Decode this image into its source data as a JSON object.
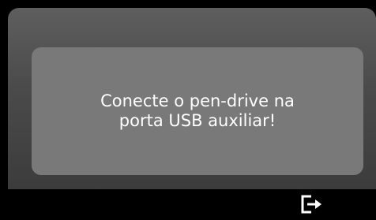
{
  "dialog": {
    "message": "Conecte o pen-drive na\nporta USB auxiliar!"
  },
  "bottom_bar": {
    "exit_icon": "exit-icon"
  },
  "colors": {
    "background": "#000000",
    "panel_top": "#5e5e5e",
    "panel_bottom": "#3c3c3c",
    "message_box": "#797979",
    "text": "#ffffff"
  }
}
